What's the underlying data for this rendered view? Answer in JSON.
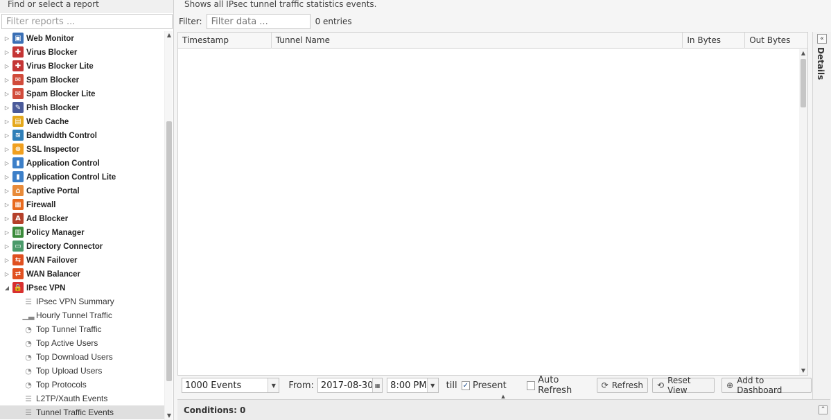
{
  "left": {
    "header": "Find or select a report",
    "filter_placeholder": "Filter reports ...",
    "apps": [
      {
        "label": "Web Monitor",
        "icon": "web-monitor-icon",
        "color": "#3a6fb5"
      },
      {
        "label": "Virus Blocker",
        "icon": "virus-blocker-icon",
        "color": "#c43535"
      },
      {
        "label": "Virus Blocker Lite",
        "icon": "virus-blocker-lite-icon",
        "color": "#c43535"
      },
      {
        "label": "Spam Blocker",
        "icon": "spam-blocker-icon",
        "color": "#d14b3b"
      },
      {
        "label": "Spam Blocker Lite",
        "icon": "spam-blocker-lite-icon",
        "color": "#d14b3b"
      },
      {
        "label": "Phish Blocker",
        "icon": "phish-blocker-icon",
        "color": "#4a5a9a"
      },
      {
        "label": "Web Cache",
        "icon": "web-cache-icon",
        "color": "#e4a81c"
      },
      {
        "label": "Bandwidth Control",
        "icon": "bandwidth-control-icon",
        "color": "#2f7fb8"
      },
      {
        "label": "SSL Inspector",
        "icon": "ssl-inspector-icon",
        "color": "#f0a020"
      },
      {
        "label": "Application Control",
        "icon": "application-control-icon",
        "color": "#3c7fc8"
      },
      {
        "label": "Application Control Lite",
        "icon": "application-control-lite-icon",
        "color": "#3c7fc8"
      },
      {
        "label": "Captive Portal",
        "icon": "captive-portal-icon",
        "color": "#e88b3a"
      },
      {
        "label": "Firewall",
        "icon": "firewall-icon",
        "color": "#e86a1e"
      },
      {
        "label": "Ad Blocker",
        "icon": "ad-blocker-icon",
        "color": "#b5402a"
      },
      {
        "label": "Policy Manager",
        "icon": "policy-manager-icon",
        "color": "#3a8a3a"
      },
      {
        "label": "Directory Connector",
        "icon": "directory-connector-icon",
        "color": "#4a9a6a"
      },
      {
        "label": "WAN Failover",
        "icon": "wan-failover-icon",
        "color": "#e05020"
      },
      {
        "label": "WAN Balancer",
        "icon": "wan-balancer-icon",
        "color": "#e05020"
      },
      {
        "label": "IPsec VPN",
        "icon": "ipsec-vpn-icon",
        "color": "#d83030"
      }
    ],
    "ipsec_children": [
      {
        "label": "IPsec VPN Summary",
        "icon": "text-report-icon"
      },
      {
        "label": "Hourly Tunnel Traffic",
        "icon": "bar-chart-icon"
      },
      {
        "label": "Top Tunnel Traffic",
        "icon": "pie-chart-icon"
      },
      {
        "label": "Top Active Users",
        "icon": "pie-chart-icon"
      },
      {
        "label": "Top Download Users",
        "icon": "pie-chart-icon"
      },
      {
        "label": "Top Upload Users",
        "icon": "pie-chart-icon"
      },
      {
        "label": "Top Protocols",
        "icon": "pie-chart-icon"
      },
      {
        "label": "L2TP/Xauth Events",
        "icon": "list-icon"
      },
      {
        "label": "Tunnel Traffic Events",
        "icon": "list-icon",
        "selected": true
      }
    ]
  },
  "main": {
    "description": "Shows all IPsec tunnel traffic statistics events.",
    "filter_label": "Filter:",
    "filter_placeholder": "Filter data ...",
    "entries": "0 entries",
    "columns": [
      "Timestamp",
      "Tunnel Name",
      "In Bytes",
      "Out Bytes"
    ]
  },
  "toolbar": {
    "events_value": "1000 Events",
    "from_label": "From:",
    "date_value": "2017-08-30",
    "time_value": "8:00 PM",
    "till_label": "till",
    "present_label": "Present",
    "auto_refresh_label": "Auto Refresh",
    "refresh_label": "Refresh",
    "reset_view_label": "Reset View",
    "add_dashboard_label": "Add to Dashboard"
  },
  "conditions": {
    "text": "Conditions: 0"
  },
  "details": {
    "label": "Details"
  }
}
